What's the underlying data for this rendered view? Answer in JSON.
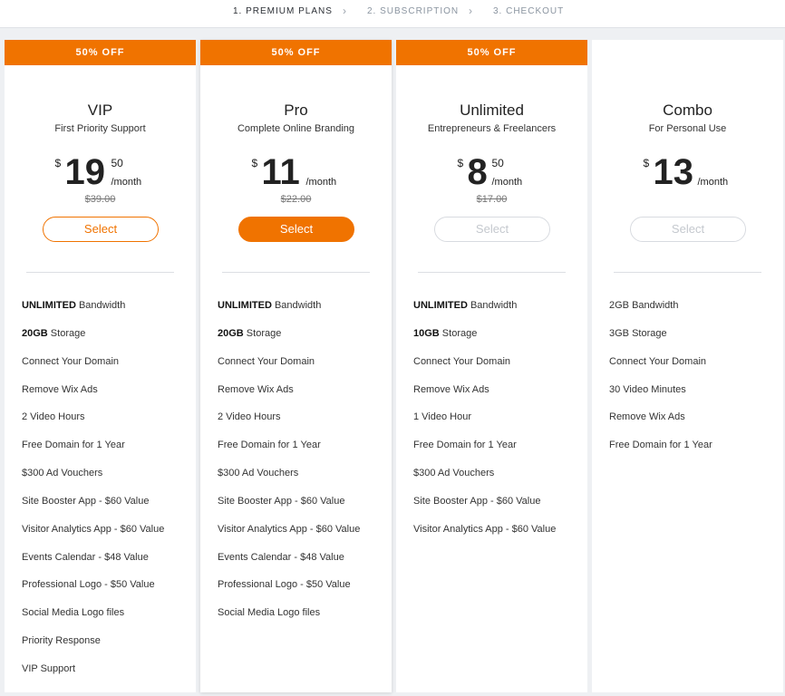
{
  "steps": [
    {
      "label": "1.  PREMIUM PLANS"
    },
    {
      "label": "2.  SUBSCRIPTION"
    },
    {
      "label": "3.  CHECKOUT"
    }
  ],
  "chevron": "›",
  "currency_symbol": "$",
  "period_label": "/month",
  "select_label": "Select",
  "accent_color": "#f07300",
  "plans": [
    {
      "ribbon": "50% OFF",
      "name": "VIP",
      "subtitle": "First Priority Support",
      "price": "19",
      "cents": "50",
      "old_price": "$39.00",
      "features": [
        {
          "strong": "UNLIMITED",
          "text": " Bandwidth"
        },
        {
          "strong": "20GB",
          "text": " Storage"
        },
        {
          "strong": "",
          "text": "Connect Your Domain"
        },
        {
          "strong": "",
          "text": "Remove Wix Ads"
        },
        {
          "strong": "",
          "text": "2 Video Hours"
        },
        {
          "strong": "",
          "text": "Free Domain for 1 Year"
        },
        {
          "strong": "",
          "text": "$300 Ad Vouchers"
        },
        {
          "strong": "",
          "text": "Site Booster App - $60 Value"
        },
        {
          "strong": "",
          "text": "Visitor Analytics App - $60 Value"
        },
        {
          "strong": "",
          "text": "Events Calendar - $48 Value"
        },
        {
          "strong": "",
          "text": "Professional Logo - $50 Value"
        },
        {
          "strong": "",
          "text": "Social Media Logo files"
        },
        {
          "strong": "",
          "text": "Priority Response"
        },
        {
          "strong": "",
          "text": "VIP Support"
        }
      ]
    },
    {
      "ribbon": "50% OFF",
      "name": "Pro",
      "subtitle": "Complete Online Branding",
      "price": "11",
      "cents": "",
      "old_price": "$22.00",
      "features": [
        {
          "strong": "UNLIMITED",
          "text": " Bandwidth"
        },
        {
          "strong": "20GB",
          "text": " Storage"
        },
        {
          "strong": "",
          "text": "Connect Your Domain"
        },
        {
          "strong": "",
          "text": "Remove Wix Ads"
        },
        {
          "strong": "",
          "text": "2 Video Hours"
        },
        {
          "strong": "",
          "text": "Free Domain for 1 Year"
        },
        {
          "strong": "",
          "text": "$300 Ad Vouchers"
        },
        {
          "strong": "",
          "text": "Site Booster App - $60 Value"
        },
        {
          "strong": "",
          "text": "Visitor Analytics App - $60 Value"
        },
        {
          "strong": "",
          "text": "Events Calendar - $48 Value"
        },
        {
          "strong": "",
          "text": "Professional Logo - $50 Value"
        },
        {
          "strong": "",
          "text": "Social Media Logo files"
        }
      ]
    },
    {
      "ribbon": "50% OFF",
      "name": "Unlimited",
      "subtitle": "Entrepreneurs & Freelancers",
      "price": "8",
      "cents": "50",
      "old_price": "$17.00",
      "features": [
        {
          "strong": "UNLIMITED",
          "text": " Bandwidth"
        },
        {
          "strong": "10GB",
          "text": " Storage"
        },
        {
          "strong": "",
          "text": "Connect Your Domain"
        },
        {
          "strong": "",
          "text": "Remove Wix Ads"
        },
        {
          "strong": "",
          "text": "1 Video Hour"
        },
        {
          "strong": "",
          "text": "Free Domain for 1 Year"
        },
        {
          "strong": "",
          "text": "$300 Ad Vouchers"
        },
        {
          "strong": "",
          "text": "Site Booster App - $60 Value"
        },
        {
          "strong": "",
          "text": "Visitor Analytics App - $60 Value"
        }
      ]
    },
    {
      "ribbon": "",
      "name": "Combo",
      "subtitle": "For Personal Use",
      "price": "13",
      "cents": "",
      "old_price": "",
      "features": [
        {
          "strong": "",
          "text": "2GB Bandwidth"
        },
        {
          "strong": "",
          "text": "3GB Storage"
        },
        {
          "strong": "",
          "text": "Connect Your Domain"
        },
        {
          "strong": "",
          "text": "30 Video Minutes"
        },
        {
          "strong": "",
          "text": "Remove Wix Ads"
        },
        {
          "strong": "",
          "text": "Free Domain for 1 Year"
        }
      ]
    }
  ]
}
